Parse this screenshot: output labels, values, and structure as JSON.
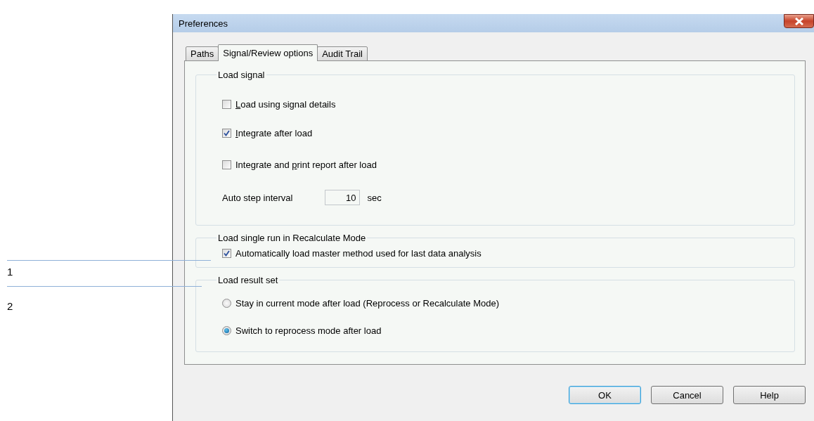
{
  "window": {
    "title": "Preferences"
  },
  "tabs": [
    {
      "label": "Paths",
      "selected": false
    },
    {
      "label": "Signal/Review options",
      "selected": true
    },
    {
      "label": "Audit Trail",
      "selected": false
    }
  ],
  "groups": [
    {
      "title": "Load signal",
      "items": [
        {
          "kind": "checkbox",
          "accel": "L",
          "after": "oad using signal details",
          "checked": false
        },
        {
          "kind": "checkbox",
          "accel": "I",
          "after": "ntegrate after load",
          "checked": true
        },
        {
          "kind": "checkbox",
          "before": "Integrate and ",
          "accel": "p",
          "after": "rint report after load",
          "checked": false
        },
        {
          "kind": "number",
          "label": "Auto step interval",
          "value": "10",
          "unit": "sec"
        }
      ]
    },
    {
      "title": "Load single run in Recalculate Mode",
      "items": [
        {
          "kind": "checkbox",
          "label": "Automatically load master method used for last data analysis",
          "checked": true
        }
      ]
    },
    {
      "title": "Load result set",
      "items": [
        {
          "kind": "radio",
          "label": "Stay in current mode after load (Reprocess or Recalculate Mode)",
          "selected": false
        },
        {
          "kind": "radio",
          "label": "Switch to reprocess mode after load",
          "selected": true
        }
      ]
    }
  ],
  "buttons": [
    {
      "label": "OK",
      "default": true
    },
    {
      "label": "Cancel",
      "default": false
    },
    {
      "label": "Help",
      "default": false
    }
  ],
  "callouts": [
    "1",
    "2"
  ]
}
